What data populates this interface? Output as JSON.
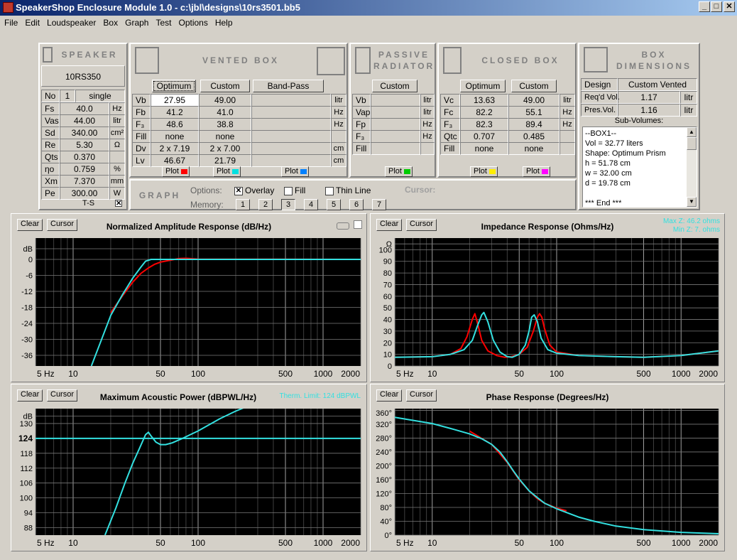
{
  "window": {
    "title": "SpeakerShop Enclosure Module 1.0 - c:\\jbl\\designs\\10rs3501.bb5"
  },
  "menu": [
    "File",
    "Edit",
    "Loudspeaker",
    "Box",
    "Graph",
    "Test",
    "Options",
    "Help"
  ],
  "speaker": {
    "header": "SPEAKER",
    "model": "10RS350",
    "no_label": "No",
    "no_value": "1",
    "mode": "single",
    "rows": [
      {
        "label": "Fs",
        "value": "40.0",
        "unit": "Hz"
      },
      {
        "label": "Vas",
        "value": "44.00",
        "unit": "litr"
      },
      {
        "label": "Sd",
        "value": "340.00",
        "unit": "cm²"
      },
      {
        "label": "Re",
        "value": "5.30",
        "unit": "Ω"
      },
      {
        "label": "Qts",
        "value": "0.370",
        "unit": ""
      },
      {
        "label": "ηo",
        "value": "0.759",
        "unit": "%"
      },
      {
        "label": "Xm",
        "value": "7.370",
        "unit": "mm"
      },
      {
        "label": "Pe",
        "value": "300.00",
        "unit": "W"
      }
    ],
    "ts_label": "T-S"
  },
  "vented": {
    "header": "VENTED BOX",
    "tab_optimum": "Optimum",
    "tab_custom": "Custom",
    "tab_bandpass": "Band-Pass",
    "rows": [
      {
        "label": "Vb",
        "opt": "27.95",
        "cust": "49.00",
        "unit": "litr"
      },
      {
        "label": "Fb",
        "opt": "41.2",
        "cust": "41.0",
        "unit": "Hz"
      },
      {
        "label": "F₃",
        "opt": "48.6",
        "cust": "38.8",
        "unit": "Hz"
      },
      {
        "label": "Fill",
        "opt": "none",
        "cust": "none",
        "unit": ""
      },
      {
        "label": "Dv",
        "opt": "2 x 7.19",
        "cust": "2 x 7.00",
        "unit": "cm"
      },
      {
        "label": "Lv",
        "opt": "46.67",
        "cust": "21.79",
        "unit": "cm"
      }
    ]
  },
  "passive": {
    "header1": "PASSIVE",
    "header2": "RADIATOR",
    "tab_custom": "Custom",
    "rows": [
      {
        "label": "Vb",
        "unit": "litr"
      },
      {
        "label": "Vap",
        "unit": "litr"
      },
      {
        "label": "Fp",
        "unit": "Hz"
      },
      {
        "label": "F₃",
        "unit": "Hz"
      },
      {
        "label": "Fill",
        "unit": ""
      }
    ]
  },
  "closed": {
    "header": "CLOSED BOX",
    "tab_optimum": "Optimum",
    "tab_custom": "Custom",
    "rows": [
      {
        "label": "Vc",
        "opt": "13.63",
        "cust": "49.00",
        "unit": "litr"
      },
      {
        "label": "Fc",
        "opt": "82.2",
        "cust": "55.1",
        "unit": "Hz"
      },
      {
        "label": "F₃",
        "opt": "82.3",
        "cust": "89.4",
        "unit": "Hz"
      },
      {
        "label": "Qtc",
        "opt": "0.707",
        "cust": "0.485",
        "unit": ""
      },
      {
        "label": "Fill",
        "opt": "none",
        "cust": "none",
        "unit": ""
      }
    ]
  },
  "plot_label": "Plot",
  "plot_colors": {
    "vent_opt": "#ff0000",
    "vent_cust": "#00e0e0",
    "bandpass": "#0080ff",
    "passive": "#00cc00",
    "closed_opt": "#ffee00",
    "closed_cust": "#ff00ff"
  },
  "dimensions": {
    "header1": "BOX",
    "header2": "DIMENSIONS",
    "design_label": "Design",
    "design_value": "Custom Vented",
    "reqd_label": "Req'd Vol.",
    "reqd_value": "1.17",
    "reqd_unit": "litr",
    "pres_label": "Pres.Vol.",
    "pres_value": "1.16",
    "pres_unit": "litr",
    "sub_label": "Sub-Volumes:",
    "sub_lines": [
      "--BOX1--",
      "Vol = 32.77 liters",
      "Shape: Optimum Prism",
      "h = 51.78 cm",
      "w = 32.00 cm",
      "d = 19.78 cm",
      "",
      "*** End ***"
    ]
  },
  "graph_ctrl": {
    "header": "GRAPH",
    "options_label": "Options:",
    "overlay": "Overlay",
    "fill": "Fill",
    "thin": "Thin Line",
    "memory_label": "Memory:",
    "memory": [
      "1",
      "2",
      "3",
      "4",
      "5",
      "6",
      "7"
    ],
    "cursor_label": "Cursor:"
  },
  "graph_buttons": {
    "clear": "Clear",
    "cursor": "Cursor"
  },
  "chart_data": [
    {
      "type": "line",
      "title": "Normalized Amplitude Response (dB/Hz)",
      "yunit": "dB",
      "ylim": [
        -40,
        8
      ],
      "yticks": [
        4,
        0,
        -6,
        -12,
        -18,
        -24,
        -30,
        -36
      ],
      "ytick_labels": [
        "dB",
        "0",
        "-6",
        "-12",
        "-18",
        "-24",
        "-30",
        "-36"
      ],
      "xscale": "log",
      "xlim": [
        5,
        2000
      ],
      "xtick_labels": [
        {
          "v": 5,
          "t": "5 Hz"
        },
        {
          "v": 10,
          "t": "10"
        },
        {
          "v": 50,
          "t": "50"
        },
        {
          "v": 100,
          "t": "100"
        },
        {
          "v": 500,
          "t": "500"
        },
        {
          "v": 1000,
          "t": "1000"
        },
        {
          "v": 2000,
          "t": "2000"
        }
      ],
      "series": [
        {
          "color": "#ff0000",
          "x": [
            20,
            25,
            30,
            35,
            40,
            45,
            50,
            60,
            70,
            80,
            100,
            2000
          ],
          "y": [
            -20,
            -13.5,
            -8.5,
            -5.2,
            -3.2,
            -1.8,
            -1,
            -0.3,
            0.3,
            0.4,
            0.1,
            0
          ]
        },
        {
          "color": "#33e0e0",
          "x": [
            14,
            20,
            25,
            30,
            35,
            38,
            42,
            50,
            60,
            100,
            2000
          ],
          "y": [
            -40,
            -21,
            -13,
            -7,
            -2.8,
            -0.7,
            0,
            0,
            0,
            0,
            0
          ]
        }
      ]
    },
    {
      "type": "line",
      "title": "Impedance Response (Ohms/Hz)",
      "annotations": [
        "Max Z: 46.2 ohms",
        "Min Z: 7. ohms"
      ],
      "ylim": [
        0,
        110
      ],
      "yticks": [
        105,
        100,
        90,
        80,
        70,
        60,
        50,
        40,
        30,
        20,
        10,
        0
      ],
      "ytick_labels": [
        "Ω",
        "100",
        "90",
        "80",
        "70",
        "60",
        "50",
        "40",
        "30",
        "20",
        "10",
        "0"
      ],
      "xscale": "log",
      "xlim": [
        5,
        2000
      ],
      "xtick_labels": [
        {
          "v": 5,
          "t": "5 Hz"
        },
        {
          "v": 10,
          "t": "10"
        },
        {
          "v": 50,
          "t": "50"
        },
        {
          "v": 100,
          "t": "100"
        },
        {
          "v": 500,
          "t": "500"
        },
        {
          "v": 1000,
          "t": "1000"
        },
        {
          "v": 2000,
          "t": "2000"
        }
      ],
      "series": [
        {
          "color": "#ff0000",
          "x": [
            5,
            10,
            14,
            17,
            19,
            21,
            22,
            23,
            25,
            28,
            33,
            38,
            43,
            50,
            58,
            65,
            70,
            73,
            76,
            80,
            88,
            100,
            150,
            300,
            500,
            1000,
            2000
          ],
          "y": [
            7.5,
            8,
            10,
            15,
            25,
            40,
            45,
            38,
            22,
            13,
            9,
            7.5,
            8,
            10,
            16,
            30,
            42,
            45,
            42,
            32,
            18,
            12,
            9,
            8,
            7.5,
            9,
            13
          ]
        },
        {
          "color": "#33e0e0",
          "x": [
            5,
            10,
            14,
            18,
            21,
            23,
            25,
            26,
            28,
            31,
            35,
            40,
            44,
            50,
            56,
            60,
            63,
            66,
            70,
            75,
            85,
            100,
            150,
            300,
            500,
            1000,
            2000
          ],
          "y": [
            7.5,
            8,
            10,
            14,
            22,
            34,
            44,
            46,
            38,
            22,
            12,
            8,
            7.5,
            10,
            18,
            30,
            42,
            44,
            38,
            24,
            14,
            11,
            9,
            8,
            7.5,
            9,
            13
          ]
        }
      ]
    },
    {
      "type": "line",
      "title": "Maximum Acoustic Power (dBPWL/Hz)",
      "annotations": [
        "Therm. Limit: 124 dBPWL"
      ],
      "ylim": [
        85,
        136
      ],
      "yticks": [
        133,
        130,
        124,
        118,
        112,
        106,
        100,
        94,
        88
      ],
      "ytick_labels": [
        "dB",
        "130",
        "124",
        "118",
        "112",
        "106",
        "100",
        "94",
        "88"
      ],
      "xscale": "log",
      "xlim": [
        5,
        2000
      ],
      "xtick_labels": [
        {
          "v": 5,
          "t": "5 Hz"
        },
        {
          "v": 10,
          "t": "10"
        },
        {
          "v": 50,
          "t": "50"
        },
        {
          "v": 100,
          "t": "100"
        },
        {
          "v": 500,
          "t": "500"
        },
        {
          "v": 1000,
          "t": "1000"
        },
        {
          "v": 2000,
          "t": "2000"
        }
      ],
      "series": [
        {
          "color": "#33e0e0",
          "x": [
            5,
            2000
          ],
          "y": [
            124,
            124
          ]
        },
        {
          "color": "#33e0e0",
          "x": [
            18,
            22,
            26,
            30,
            34,
            38,
            40,
            42,
            46,
            50,
            55,
            62,
            75,
            100,
            150,
            200,
            250,
            300
          ],
          "y": [
            85,
            96,
            106,
            114,
            120,
            125.5,
            126.5,
            125,
            122.5,
            121.5,
            121.5,
            122.2,
            124,
            127,
            132,
            135,
            137,
            138
          ]
        }
      ]
    },
    {
      "type": "line",
      "title": "Phase Response (Degrees/Hz)",
      "ylim": [
        0,
        365
      ],
      "yticks": [
        360,
        320,
        280,
        240,
        200,
        160,
        120,
        80,
        40,
        0
      ],
      "ytick_labels": [
        "360°",
        "320°",
        "280°",
        "240°",
        "200°",
        "160°",
        "120°",
        "80°",
        "40°",
        "0°"
      ],
      "xscale": "log",
      "xlim": [
        5,
        2000
      ],
      "xtick_labels": [
        {
          "v": 5,
          "t": "5 Hz"
        },
        {
          "v": 10,
          "t": "10"
        },
        {
          "v": 50,
          "t": "50"
        },
        {
          "v": 100,
          "t": "100"
        },
        {
          "v": 500,
          "t": "500"
        },
        {
          "v": 1000,
          "t": "1000"
        },
        {
          "v": 2000,
          "t": "2000"
        }
      ],
      "series": [
        {
          "color": "#ff0000",
          "x": [
            20,
            30,
            40,
            50,
            60,
            70,
            80,
            100,
            120
          ],
          "y": [
            300,
            262,
            210,
            160,
            128,
            105,
            92,
            78,
            70
          ]
        },
        {
          "color": "#33e0e0",
          "x": [
            5,
            10,
            15,
            20,
            25,
            30,
            35,
            40,
            45,
            50,
            60,
            70,
            80,
            100,
            150,
            200,
            300,
            500,
            1000,
            2000
          ],
          "y": [
            340,
            322,
            305,
            292,
            278,
            262,
            240,
            212,
            185,
            162,
            128,
            108,
            92,
            76,
            52,
            40,
            26,
            16,
            8,
            4
          ]
        }
      ]
    }
  ]
}
